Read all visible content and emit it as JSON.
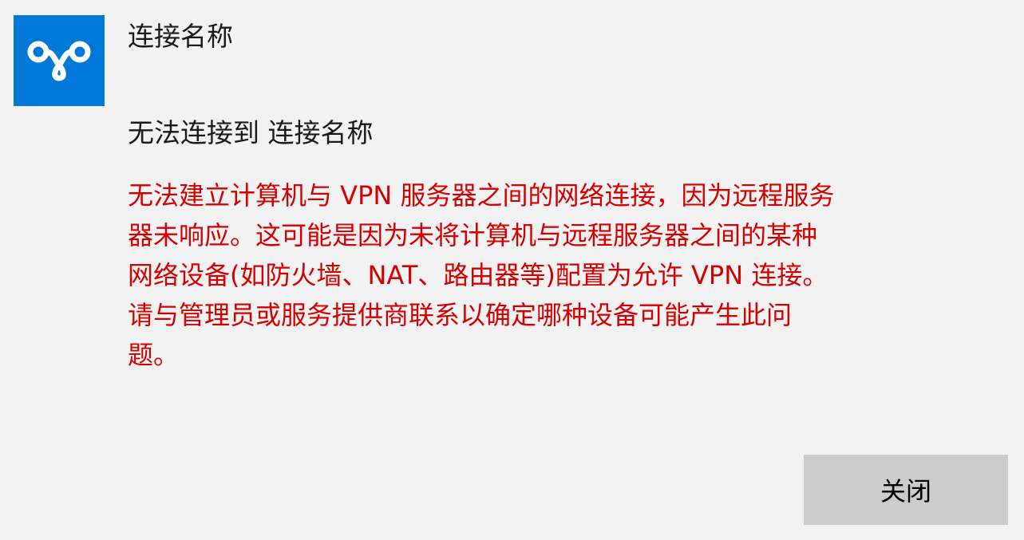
{
  "dialog": {
    "app_icon": "vpn-connection-icon",
    "connection_name": "连接名称",
    "status_heading": "无法连接到 连接名称",
    "error_lines": [
      "无法建立计算机与 VPN 服务器之间的网络连接，因为远程服务",
      "器未响应。这可能是因为未将计算机与远程服务器之间的某种",
      "网络设备(如防火墙、NAT、路由器等)配置为允许 VPN 连接。",
      "请与管理员或服务提供商联系以确定哪种设备可能产生此问",
      "题。"
    ],
    "close_button_label": "关闭"
  },
  "colors": {
    "accent": "#0078d7",
    "error": "#d40000",
    "background": "#f2f2f2",
    "button": "#cccccc"
  }
}
